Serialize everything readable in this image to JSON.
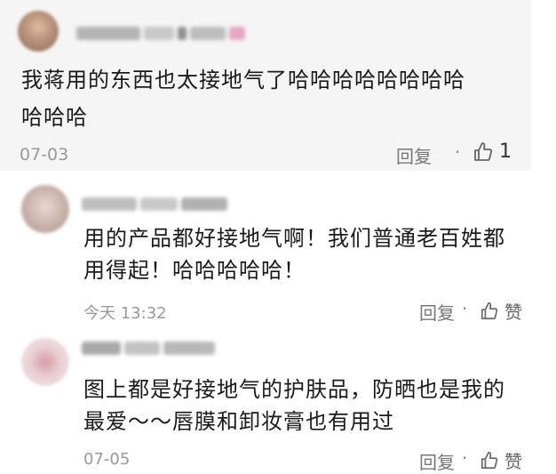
{
  "comments": [
    {
      "text_line1": "我蒋用的东西也太接地气了哈哈哈哈哈哈哈哈",
      "text_line2": "哈哈哈",
      "time": "07-03",
      "reply_label": "回复",
      "like_text": "1"
    },
    {
      "text_line1": "用的产品都好接地气啊！我们普通老百姓都",
      "text_line2": "用得起！哈哈哈哈哈！",
      "time": "今天 13:32",
      "reply_label": "回复",
      "like_text": "赞"
    },
    {
      "text_line1": "图上都是好接地气的护肤品，防晒也是我的",
      "text_line2": "最爱～～唇膜和卸妆膏也有用过",
      "time": "07-05",
      "reply_label": "回复",
      "like_text": "赞"
    }
  ],
  "icons": {
    "like": "thumbs-up-icon"
  },
  "colors": {
    "highlight_bg": "#f5f5f5",
    "meta_text": "#999999",
    "body_text": "#1a1a1a"
  }
}
